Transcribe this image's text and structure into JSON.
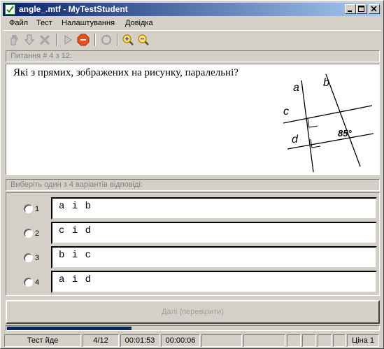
{
  "window": {
    "title": "angle_.mtf - MyTestStudent"
  },
  "menu": {
    "items": [
      "Файл",
      "Тест",
      "Налаштування",
      "Довідка"
    ]
  },
  "toolbar": {
    "icons": [
      "hand-icon",
      "down-arrow-icon",
      "cross-icon",
      "play-icon",
      "stop-icon",
      "refresh-icon",
      "zoom-in-icon",
      "zoom-out-icon"
    ]
  },
  "question": {
    "header": "Питання # 4 з 12:",
    "text": "Які з прямих, зображених на рисунку, паралельні?",
    "figure": {
      "labels": [
        "a",
        "b",
        "c",
        "d"
      ],
      "angle": "85°"
    }
  },
  "answers": {
    "header": "Виберіть один з 4 варіантів відповіді:",
    "options": [
      {
        "num": "1",
        "text": "a i b"
      },
      {
        "num": "2",
        "text": "c i d"
      },
      {
        "num": "3",
        "text": "b i c"
      },
      {
        "num": "4",
        "text": "a i d"
      }
    ]
  },
  "next_button": {
    "label": "Далі (перевірити)"
  },
  "progress": {
    "fraction": 0.335
  },
  "status": {
    "state": "Тест йде",
    "counter": "4/12",
    "elapsed": "00:01:53",
    "question_time": "00:00:06",
    "price": "Ціна 1"
  },
  "colors": {
    "title_start": "#0a246a",
    "title_end": "#a6caf0",
    "progress": "#0a246a",
    "stop_icon": "#e8501a"
  }
}
